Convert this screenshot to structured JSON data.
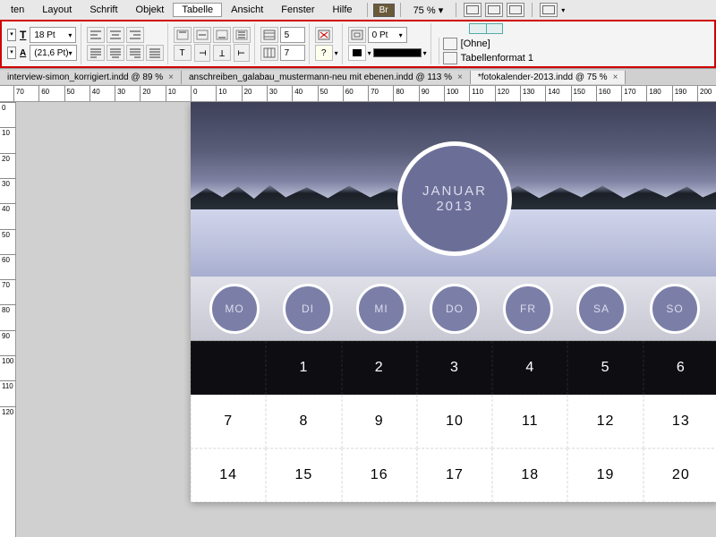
{
  "menu": {
    "items": [
      "ten",
      "Layout",
      "Schrift",
      "Objekt",
      "Tabelle",
      "Ansicht",
      "Fenster",
      "Hilfe"
    ],
    "active": "Tabelle",
    "br": "Br",
    "zoom": "75 %",
    "zoom_arrow": "▾"
  },
  "panel": {
    "fontSize": "18 Pt",
    "leading": "(21,6 Pt)",
    "rows": "5",
    "cols": "7",
    "inset": "0 Pt",
    "ohne": "[Ohne]",
    "tf": "Tabellenformat 1"
  },
  "tabs": [
    {
      "label": "interview-simon_korrigiert.indd @ 89 %",
      "active": false
    },
    {
      "label": "anschreiben_galabau_mustermann-neu mit ebenen.indd @ 113 %",
      "active": false
    },
    {
      "label": "*fotokalender-2013.indd @ 75 %",
      "active": true
    }
  ],
  "ruler": {
    "marks": [
      0,
      10,
      20,
      30,
      40,
      50,
      60,
      70,
      80,
      90,
      100,
      110,
      120,
      130,
      140,
      150,
      160,
      170,
      180,
      190,
      200
    ]
  },
  "vruler": {
    "marks": [
      0,
      10,
      20,
      30,
      40,
      50,
      60,
      70,
      80,
      90,
      100,
      110,
      120
    ]
  },
  "calendar": {
    "month": "JANUAR",
    "year": "2013",
    "days": [
      "MO",
      "DI",
      "MI",
      "DO",
      "FR",
      "SA",
      "SO"
    ],
    "rows": [
      [
        "",
        "1",
        "2",
        "3",
        "4",
        "5",
        "6"
      ],
      [
        "7",
        "8",
        "9",
        "10",
        "11",
        "12",
        "13"
      ],
      [
        "14",
        "15",
        "16",
        "17",
        "18",
        "19",
        "20"
      ]
    ]
  }
}
